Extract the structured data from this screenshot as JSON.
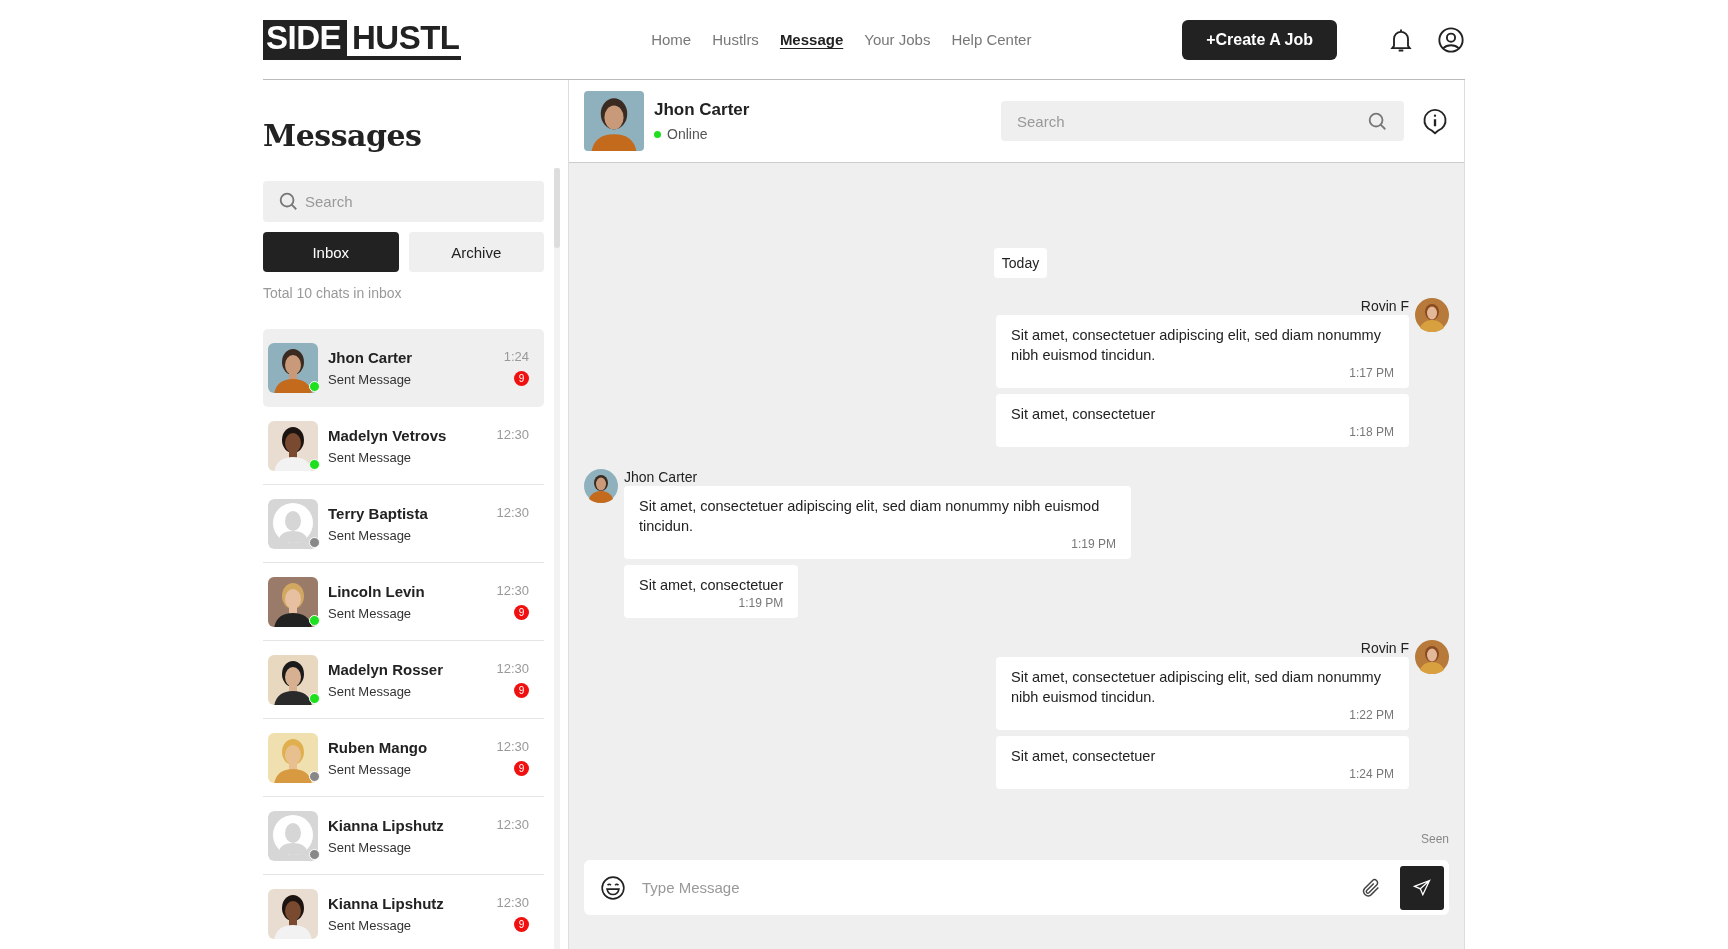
{
  "logo": {
    "part_1": "SIDE",
    "part_2": "HUSTL"
  },
  "nav": [
    {
      "label": "Home",
      "selected": false
    },
    {
      "label": "Hustlrs",
      "selected": false
    },
    {
      "label": "Message",
      "selected": true
    },
    {
      "label": "Your Jobs",
      "selected": false
    },
    {
      "label": "Help Center",
      "selected": false
    }
  ],
  "create_button": "+Create A Job",
  "sidebar": {
    "title": "Messages",
    "search": {
      "placeholder": "Search"
    },
    "tabs": [
      {
        "label": "Inbox",
        "selected": true
      },
      {
        "label": "Archive",
        "selected": false
      }
    ],
    "total": "Total 10 chats in inbox",
    "chats": [
      {
        "name": "Jhon Carter",
        "preview": "Sent Message",
        "time": "1:24",
        "unread": "9",
        "online": true,
        "selected": true
      },
      {
        "name": "Madelyn Vetrovs",
        "preview": "Sent Message",
        "time": "12:30",
        "online": true,
        "selected": false
      },
      {
        "name": "Terry Baptista",
        "preview": "Sent Message",
        "time": "12:30",
        "kind": "placeholder",
        "online": false,
        "selected": false
      },
      {
        "name": "Lincoln Levin",
        "preview": "Sent Message",
        "time": "12:30",
        "unread": "9",
        "online": true,
        "selected": false
      },
      {
        "name": "Madelyn Rosser",
        "preview": "Sent Message",
        "time": "12:30",
        "unread": "9",
        "online": true,
        "selected": false
      },
      {
        "name": "Ruben Mango",
        "preview": "Sent Message",
        "time": "12:30",
        "unread": "9",
        "online": false,
        "selected": false
      },
      {
        "name": "Kianna Lipshutz",
        "preview": "Sent Message",
        "time": "12:30",
        "kind": "placeholder",
        "online": false,
        "selected": false
      },
      {
        "name": "Kianna Lipshutz",
        "preview": "Sent Message",
        "time": "12:30",
        "unread": "9",
        "selected": false
      }
    ]
  },
  "chat": {
    "contact": {
      "name": "Jhon Carter",
      "status": "Online",
      "online": true
    },
    "search": {
      "placeholder": "Search"
    },
    "messages": [
      {
        "kind": "date",
        "text": "Today"
      },
      {
        "kind": "outgoing",
        "sender": "Rovin F",
        "bubbles": [
          {
            "text": "Sit amet, consectetuer adipiscing elit, sed diam nonummy nibh euismod tincidun.",
            "time": "1:17 PM"
          },
          {
            "text": "Sit amet, consectetuer",
            "time": "1:18 PM"
          }
        ]
      },
      {
        "kind": "incoming",
        "sender": "Jhon Carter",
        "bubbles": [
          {
            "text": "Sit amet, consectetuer adipiscing elit, sed diam nonummy nibh euismod tincidun.",
            "time": "1:19 PM"
          },
          {
            "text": "Sit amet, consectetuer",
            "time": "1:19 PM"
          }
        ]
      },
      {
        "kind": "outgoing",
        "sender": "Rovin F",
        "bubbles": [
          {
            "text": "Sit amet, consectetuer adipiscing elit, sed diam nonummy nibh euismod tincidun.",
            "time": "1:22 PM"
          },
          {
            "text": "Sit amet, consectetuer",
            "time": "1:24 PM"
          }
        ]
      }
    ],
    "seen": "Seen",
    "composer": {
      "placeholder": "Type Message"
    }
  }
}
